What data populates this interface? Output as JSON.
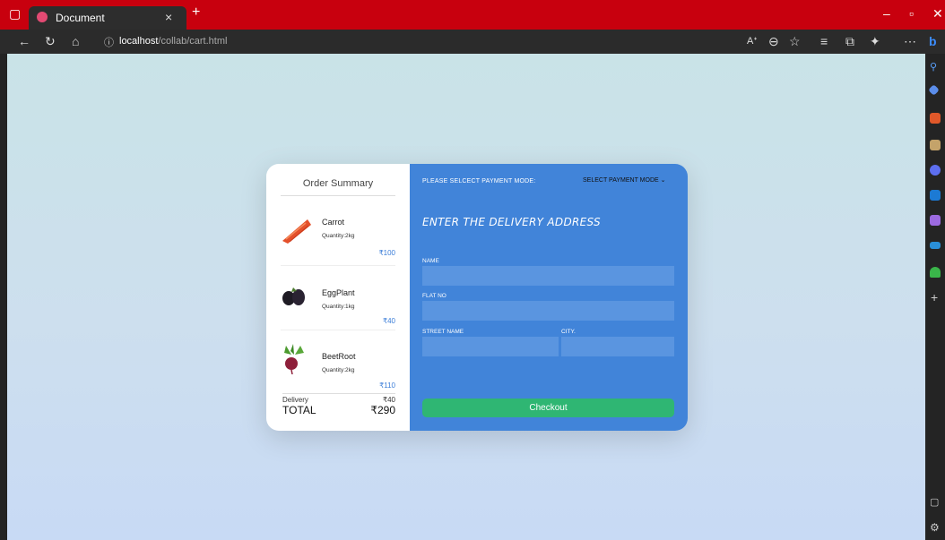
{
  "browser": {
    "tab_title": "Document",
    "tab_close": "×",
    "new_tab": "+",
    "url_host": "localhost",
    "url_path": "/collab/cart.html"
  },
  "summary": {
    "title": "Order Summary",
    "items": [
      {
        "name": "Carrot",
        "quantity": "Quantity:2kg",
        "price": "₹100"
      },
      {
        "name": "EggPlant",
        "quantity": "Quantity:1kg",
        "price": "₹40"
      },
      {
        "name": "BeetRoot",
        "quantity": "Quantity:2kg",
        "price": "₹110"
      }
    ],
    "delivery_label": "Delivery",
    "delivery_value": "₹40",
    "total_label": "TOTAL",
    "total_value": "₹290"
  },
  "form": {
    "payment_label": "PLEASE SELCECT PAYMENT MODE:",
    "payment_select": "SELECT PAYMENT MODE",
    "address_heading": "ENTER THE DELIVERY ADDRESS",
    "name_label": "NAME",
    "flat_label": "FLAT NO",
    "street_label": "STREET NAME",
    "city_label": "CITY.",
    "checkout_label": "Checkout"
  }
}
